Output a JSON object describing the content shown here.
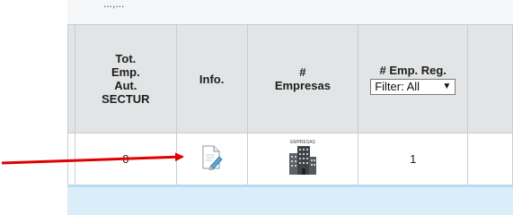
{
  "top_strip": {
    "clipped_text": "...,..."
  },
  "headers": {
    "tot_emp_lines": [
      "Tot.",
      "Emp.",
      "Aut.",
      "SECTUR"
    ],
    "info": "Info.",
    "empresas_lines": [
      "#",
      "Empresas"
    ],
    "emp_reg": "# Emp. Reg.",
    "filter_value": "Filter: All"
  },
  "row": {
    "tot_emp_value": "0",
    "empresas_icon_label": "EMPRESAS",
    "emp_reg_value": "1"
  },
  "icons": {
    "info": "edit-document-icon",
    "empresas": "building-icon",
    "filter_caret": "triangle-down-icon",
    "arrow": "arrow-right-icon"
  },
  "colors": {
    "header_bg": "#e2e4e5",
    "arrow": "#e00000",
    "band": "#daeefa"
  }
}
